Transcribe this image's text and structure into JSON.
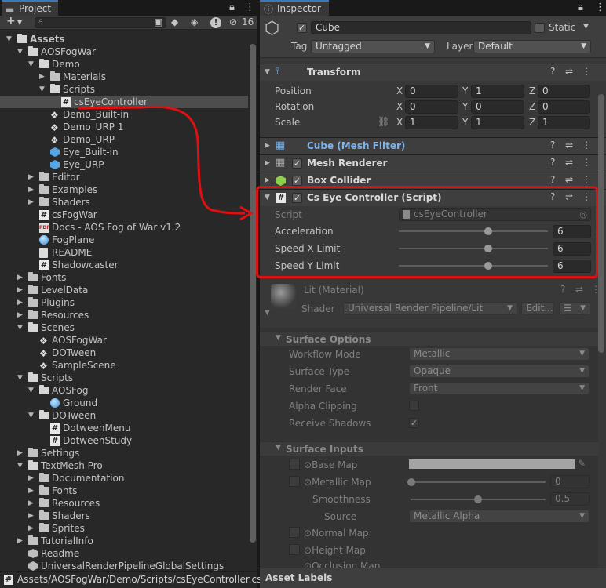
{
  "project": {
    "tab_label": "Project",
    "hidden_count": "16",
    "tree": [
      {
        "label": "Assets",
        "indent": 0,
        "arrow": "down",
        "icon": "folder-open",
        "bold": true
      },
      {
        "label": "AOSFogWar",
        "indent": 1,
        "arrow": "down",
        "icon": "folder-open"
      },
      {
        "label": "Demo",
        "indent": 2,
        "arrow": "down",
        "icon": "folder-open"
      },
      {
        "label": "Materials",
        "indent": 3,
        "arrow": "right",
        "icon": "folder"
      },
      {
        "label": "Scripts",
        "indent": 3,
        "arrow": "down",
        "icon": "folder-open"
      },
      {
        "label": "csEyeController",
        "indent": 4,
        "arrow": "",
        "icon": "script",
        "selected": true
      },
      {
        "label": "Demo_Built-in",
        "indent": 3,
        "arrow": "",
        "icon": "unity-scene"
      },
      {
        "label": "Demo_URP 1",
        "indent": 3,
        "arrow": "",
        "icon": "unity-scene"
      },
      {
        "label": "Demo_URP",
        "indent": 3,
        "arrow": "",
        "icon": "unity-scene"
      },
      {
        "label": "Eye_Built-in",
        "indent": 3,
        "arrow": "",
        "icon": "prefab"
      },
      {
        "label": "Eye_URP",
        "indent": 3,
        "arrow": "",
        "icon": "prefab"
      },
      {
        "label": "Editor",
        "indent": 2,
        "arrow": "right",
        "icon": "folder"
      },
      {
        "label": "Examples",
        "indent": 2,
        "arrow": "right",
        "icon": "folder"
      },
      {
        "label": "Shaders",
        "indent": 2,
        "arrow": "right",
        "icon": "folder"
      },
      {
        "label": "csFogWar",
        "indent": 2,
        "arrow": "",
        "icon": "script"
      },
      {
        "label": "Docs - AOS Fog of War v1.2",
        "indent": 2,
        "arrow": "",
        "icon": "pdf"
      },
      {
        "label": "FogPlane",
        "indent": 2,
        "arrow": "",
        "icon": "material"
      },
      {
        "label": "README",
        "indent": 2,
        "arrow": "",
        "icon": "document"
      },
      {
        "label": "Shadowcaster",
        "indent": 2,
        "arrow": "",
        "icon": "script"
      },
      {
        "label": "Fonts",
        "indent": 1,
        "arrow": "right",
        "icon": "folder"
      },
      {
        "label": "LevelData",
        "indent": 1,
        "arrow": "right",
        "icon": "folder"
      },
      {
        "label": "Plugins",
        "indent": 1,
        "arrow": "right",
        "icon": "folder"
      },
      {
        "label": "Resources",
        "indent": 1,
        "arrow": "right",
        "icon": "folder"
      },
      {
        "label": "Scenes",
        "indent": 1,
        "arrow": "down",
        "icon": "folder-open"
      },
      {
        "label": "AOSFogWar",
        "indent": 2,
        "arrow": "",
        "icon": "unity-scene"
      },
      {
        "label": "DOTween",
        "indent": 2,
        "arrow": "",
        "icon": "unity-scene"
      },
      {
        "label": "SampleScene",
        "indent": 2,
        "arrow": "",
        "icon": "unity-scene"
      },
      {
        "label": "Scripts",
        "indent": 1,
        "arrow": "down",
        "icon": "folder-open"
      },
      {
        "label": "AOSFog",
        "indent": 2,
        "arrow": "down",
        "icon": "folder-open"
      },
      {
        "label": "Ground",
        "indent": 3,
        "arrow": "",
        "icon": "material"
      },
      {
        "label": "DOTween",
        "indent": 2,
        "arrow": "down",
        "icon": "folder-open"
      },
      {
        "label": "DotweenMenu",
        "indent": 3,
        "arrow": "",
        "icon": "script"
      },
      {
        "label": "DotweenStudy",
        "indent": 3,
        "arrow": "",
        "icon": "script"
      },
      {
        "label": "Settings",
        "indent": 1,
        "arrow": "right",
        "icon": "folder"
      },
      {
        "label": "TextMesh Pro",
        "indent": 1,
        "arrow": "down",
        "icon": "folder-open"
      },
      {
        "label": "Documentation",
        "indent": 2,
        "arrow": "right",
        "icon": "folder"
      },
      {
        "label": "Fonts",
        "indent": 2,
        "arrow": "right",
        "icon": "folder"
      },
      {
        "label": "Resources",
        "indent": 2,
        "arrow": "right",
        "icon": "folder"
      },
      {
        "label": "Shaders",
        "indent": 2,
        "arrow": "right",
        "icon": "folder"
      },
      {
        "label": "Sprites",
        "indent": 2,
        "arrow": "right",
        "icon": "folder"
      },
      {
        "label": "TutorialInfo",
        "indent": 1,
        "arrow": "right",
        "icon": "folder"
      },
      {
        "label": "Readme",
        "indent": 1,
        "arrow": "",
        "icon": "gameobject"
      },
      {
        "label": "UniversalRenderPipelineGlobalSettings",
        "indent": 1,
        "arrow": "",
        "icon": "settings"
      }
    ],
    "path": "Assets/AOSFogWar/Demo/Scripts/csEyeController.cs"
  },
  "inspector": {
    "tab_label": "Inspector",
    "object_name": "Cube",
    "static_label": "Static",
    "tag_label": "Tag",
    "tag_value": "Untagged",
    "layer_label": "Layer",
    "layer_value": "Default",
    "transform": {
      "title": "Transform",
      "rows": [
        {
          "label": "Position",
          "x": "0",
          "y": "1",
          "z": "0"
        },
        {
          "label": "Rotation",
          "x": "0",
          "y": "0",
          "z": "0"
        },
        {
          "label": "Scale",
          "x": "1",
          "y": "1",
          "z": "1"
        }
      ],
      "axis": {
        "x": "X",
        "y": "Y",
        "z": "Z"
      }
    },
    "mesh_filter": "Cube (Mesh Filter)",
    "mesh_renderer": "Mesh Renderer",
    "box_collider": "Box Collider",
    "script_component": {
      "title": "Cs Eye Controller (Script)",
      "script_label": "Script",
      "script_value": "csEyeController",
      "props": [
        {
          "label": "Acceleration",
          "value": "6",
          "fraction": 0.6
        },
        {
          "label": "Speed X Limit",
          "value": "6",
          "fraction": 0.6
        },
        {
          "label": "Speed Y Limit",
          "value": "6",
          "fraction": 0.6
        }
      ]
    },
    "material": {
      "title": "Lit (Material)",
      "shader_label": "Shader",
      "shader_value": "Universal Render Pipeline/Lit",
      "edit_label": "Edit..."
    },
    "surface_options": {
      "title": "Surface Options",
      "rows": [
        {
          "label": "Workflow Mode",
          "value": "Metallic",
          "type": "dropdown"
        },
        {
          "label": "Surface Type",
          "value": "Opaque",
          "type": "dropdown"
        },
        {
          "label": "Render Face",
          "value": "Front",
          "type": "dropdown"
        },
        {
          "label": "Alpha Clipping",
          "value": "",
          "type": "checkbox"
        },
        {
          "label": "Receive Shadows",
          "value": "✓",
          "type": "checkbox"
        }
      ]
    },
    "surface_inputs": {
      "title": "Surface Inputs",
      "base_map": "Base Map",
      "metallic_map": "Metallic Map",
      "metallic_value": "0",
      "smoothness": "Smoothness",
      "smoothness_value": "0.5",
      "source": "Source",
      "source_value": "Metallic Alpha",
      "normal_map": "Normal Map",
      "height_map": "Height Map",
      "occlusion_map": "Occlusion Map"
    },
    "asset_labels": "Asset Labels"
  },
  "colors": {
    "accent": "#3a79bb",
    "annotation": "#e01010",
    "selected_row": "#4d4d4d"
  }
}
